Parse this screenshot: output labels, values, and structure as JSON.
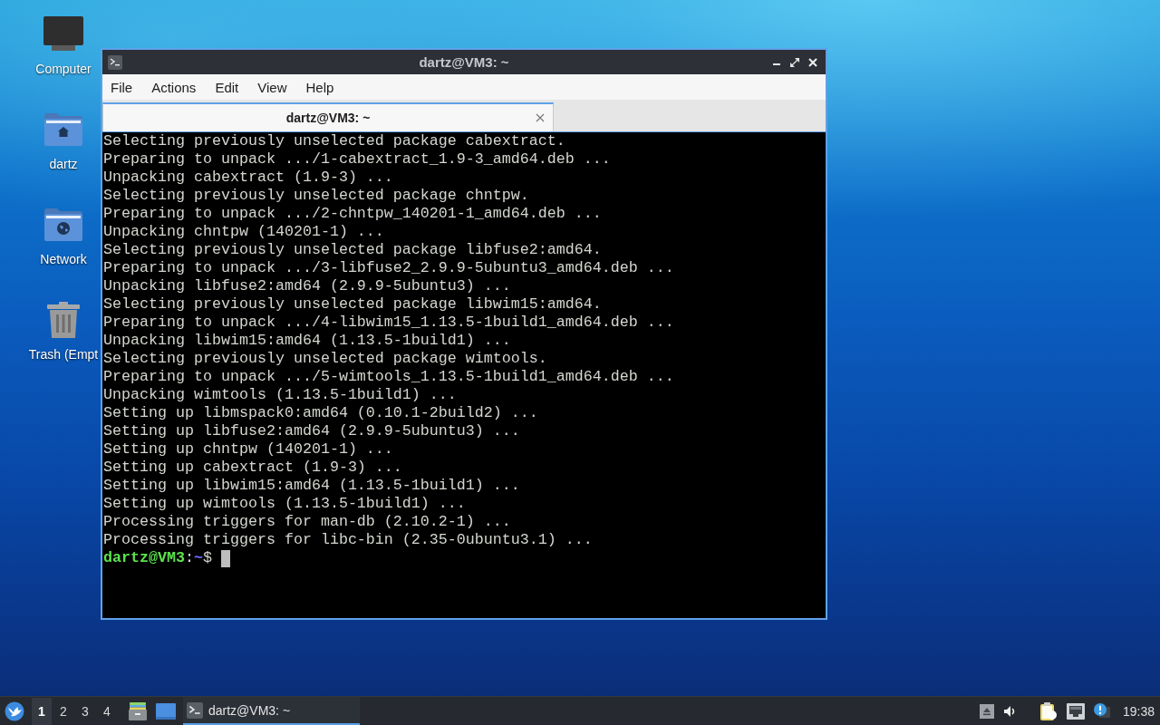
{
  "desktop_icons": [
    {
      "kind": "computer",
      "label": "Computer"
    },
    {
      "kind": "home",
      "label": "dartz"
    },
    {
      "kind": "network",
      "label": "Network"
    },
    {
      "kind": "trash",
      "label": "Trash (Empt"
    }
  ],
  "window": {
    "title": "dartz@VM3: ~",
    "menu": [
      "File",
      "Actions",
      "Edit",
      "View",
      "Help"
    ],
    "tabs": [
      {
        "label": "dartz@VM3: ~",
        "selected": true
      }
    ],
    "terminal": {
      "lines": [
        "Selecting previously unselected package cabextract.",
        "Preparing to unpack .../1-cabextract_1.9-3_amd64.deb ...",
        "Unpacking cabextract (1.9-3) ...",
        "Selecting previously unselected package chntpw.",
        "Preparing to unpack .../2-chntpw_140201-1_amd64.deb ...",
        "Unpacking chntpw (140201-1) ...",
        "Selecting previously unselected package libfuse2:amd64.",
        "Preparing to unpack .../3-libfuse2_2.9.9-5ubuntu3_amd64.deb ...",
        "Unpacking libfuse2:amd64 (2.9.9-5ubuntu3) ...",
        "Selecting previously unselected package libwim15:amd64.",
        "Preparing to unpack .../4-libwim15_1.13.5-1build1_amd64.deb ...",
        "Unpacking libwim15:amd64 (1.13.5-1build1) ...",
        "Selecting previously unselected package wimtools.",
        "Preparing to unpack .../5-wimtools_1.13.5-1build1_amd64.deb ...",
        "Unpacking wimtools (1.13.5-1build1) ...",
        "Setting up libmspack0:amd64 (0.10.1-2build2) ...",
        "Setting up libfuse2:amd64 (2.9.9-5ubuntu3) ...",
        "Setting up chntpw (140201-1) ...",
        "Setting up cabextract (1.9-3) ...",
        "Setting up libwim15:amd64 (1.13.5-1build1) ...",
        "Setting up wimtools (1.13.5-1build1) ...",
        "Processing triggers for man-db (2.10.2-1) ...",
        "Processing triggers for libc-bin (2.35-0ubuntu3.1) ..."
      ],
      "prompt": {
        "user_host": "dartz@VM3",
        "separator": ":",
        "path": "~",
        "symbol": "$"
      }
    }
  },
  "taskbar": {
    "workspaces": [
      {
        "label": "1",
        "selected": true
      },
      {
        "label": "2",
        "selected": false
      },
      {
        "label": "3",
        "selected": false
      },
      {
        "label": "4",
        "selected": false
      }
    ],
    "launchers": [
      {
        "kind": "file_manager"
      },
      {
        "kind": "show_desktop"
      }
    ],
    "tasks": [
      {
        "label": "dartz@VM3: ~",
        "selected": true
      }
    ],
    "tray": [
      {
        "kind": "eject"
      },
      {
        "kind": "volume"
      },
      {
        "kind": "clipboard"
      },
      {
        "kind": "network"
      },
      {
        "kind": "notification"
      }
    ],
    "clock": "19:38"
  }
}
